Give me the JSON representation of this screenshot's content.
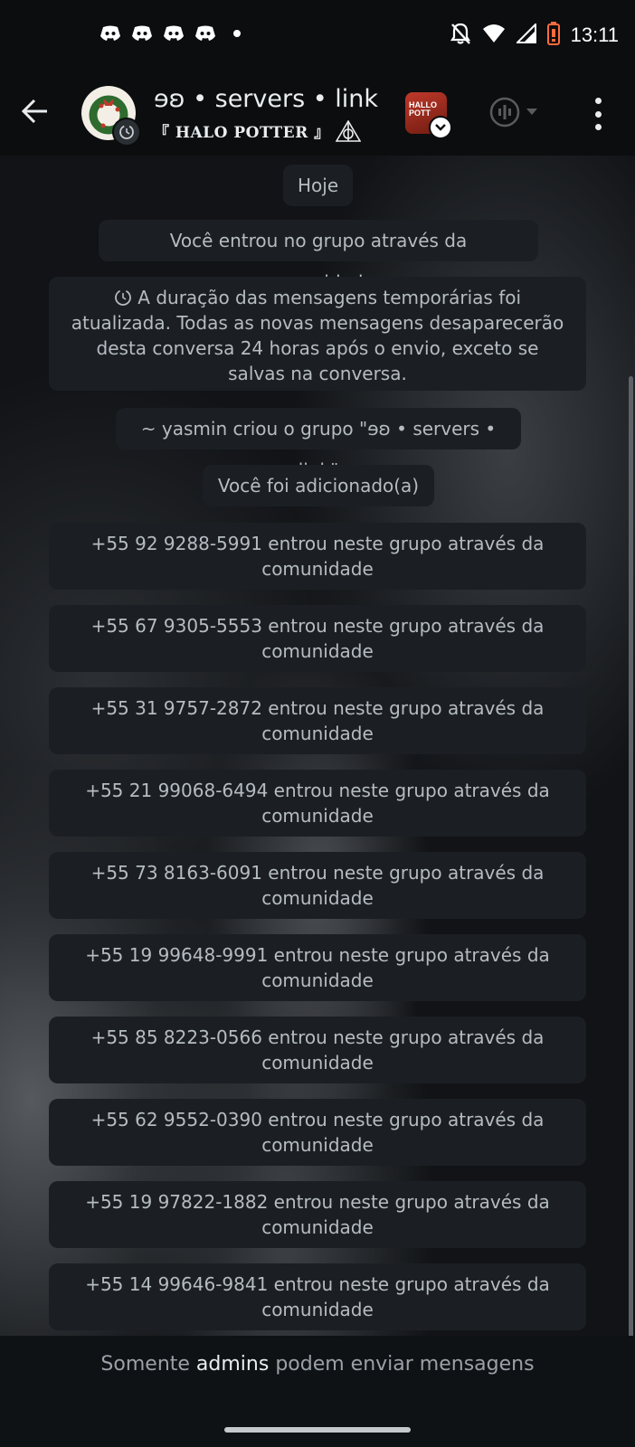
{
  "status_bar": {
    "time": "13:11",
    "notification_icons": [
      "discord-icon",
      "discord-icon",
      "discord-icon",
      "discord-icon"
    ]
  },
  "header": {
    "title": "ɘʚ • servers • link",
    "subtitle": "『 HALO POTTER 』",
    "community_thumb_text": "HALLO POTT"
  },
  "messages": [
    {
      "kind": "date",
      "text": "Hoje"
    },
    {
      "kind": "system",
      "text": "Você entrou no grupo através da comunidade"
    },
    {
      "kind": "system-multiline",
      "text": "A duração das mensagens temporárias foi atualizada. Todas as novas mensagens desaparecerão desta conversa 24 horas após o envio, exceto se salvas na conversa."
    },
    {
      "kind": "system",
      "text": "~ yasmin criou o grupo \"ɘʚ • servers • link\""
    },
    {
      "kind": "system",
      "text": "Você foi adicionado(a)"
    },
    {
      "kind": "join",
      "text": "+55 92 9288-5991 entrou neste grupo através da comunidade"
    },
    {
      "kind": "join",
      "text": "+55 67 9305-5553 entrou neste grupo através da comunidade"
    },
    {
      "kind": "join",
      "text": "+55 31 9757-2872 entrou neste grupo através da comunidade"
    },
    {
      "kind": "join",
      "text": "+55 21 99068-6494 entrou neste grupo através da comunidade"
    },
    {
      "kind": "join",
      "text": "+55 73 8163-6091 entrou neste grupo através da comunidade"
    },
    {
      "kind": "join",
      "text": "+55 19 99648-9991 entrou neste grupo através da comunidade"
    },
    {
      "kind": "join",
      "text": "+55 85 8223-0566 entrou neste grupo através da comunidade"
    },
    {
      "kind": "join",
      "text": "+55 62 9552-0390 entrou neste grupo através da comunidade"
    },
    {
      "kind": "join",
      "text": "+55 19 97822-1882 entrou neste grupo através da comunidade"
    },
    {
      "kind": "join",
      "text": "+55 14 99646-9841 entrou neste grupo através da comunidade"
    }
  ],
  "footer": {
    "prefix": "Somente ",
    "highlight": "admins",
    "suffix": " podem enviar mensagens"
  },
  "colors": {
    "background": "#0b0d0f",
    "bubble": "#1b1f23",
    "bubble_text": "#b5bcc2",
    "header_text": "#e9edef",
    "battery": "#ff6b3d"
  }
}
